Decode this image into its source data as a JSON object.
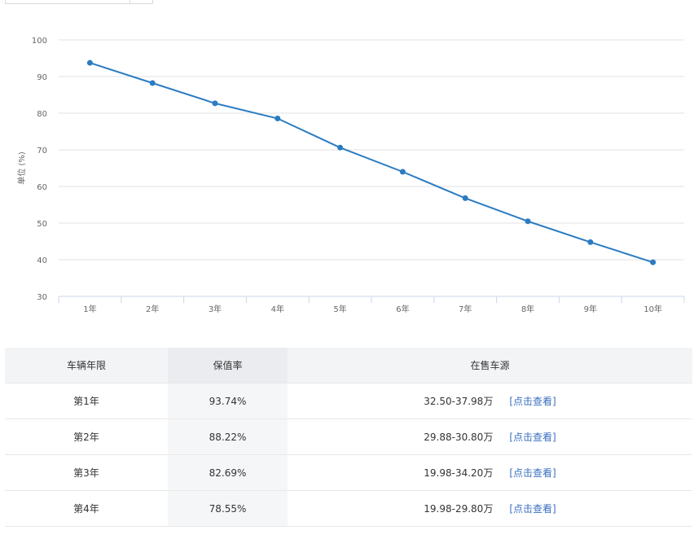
{
  "chart_data": {
    "type": "line",
    "ylabel": "单位 (%)",
    "ylim": [
      30,
      100
    ],
    "yticks": [
      30,
      40,
      50,
      60,
      70,
      80,
      90,
      100
    ],
    "categories": [
      "1年",
      "2年",
      "3年",
      "4年",
      "5年",
      "6年",
      "7年",
      "8年",
      "9年",
      "10年"
    ],
    "series": [
      {
        "values": [
          93.74,
          88.22,
          82.69,
          78.55,
          70.6,
          64.0,
          56.8,
          50.5,
          44.8,
          39.3
        ]
      }
    ],
    "grid": true,
    "color": "#2b7cc2"
  },
  "table": {
    "headers": [
      "车辆年限",
      "保值率",
      "在售车源"
    ],
    "rows": [
      {
        "year": "第1年",
        "rate": "93.74%",
        "price": "32.50-37.98万",
        "link": "[点击查看]"
      },
      {
        "year": "第2年",
        "rate": "88.22%",
        "price": "29.88-30.80万",
        "link": "[点击查看]"
      },
      {
        "year": "第3年",
        "rate": "82.69%",
        "price": "19.98-34.20万",
        "link": "[点击查看]"
      },
      {
        "year": "第4年",
        "rate": "78.55%",
        "price": "19.98-29.80万",
        "link": "[点击查看]"
      }
    ]
  }
}
